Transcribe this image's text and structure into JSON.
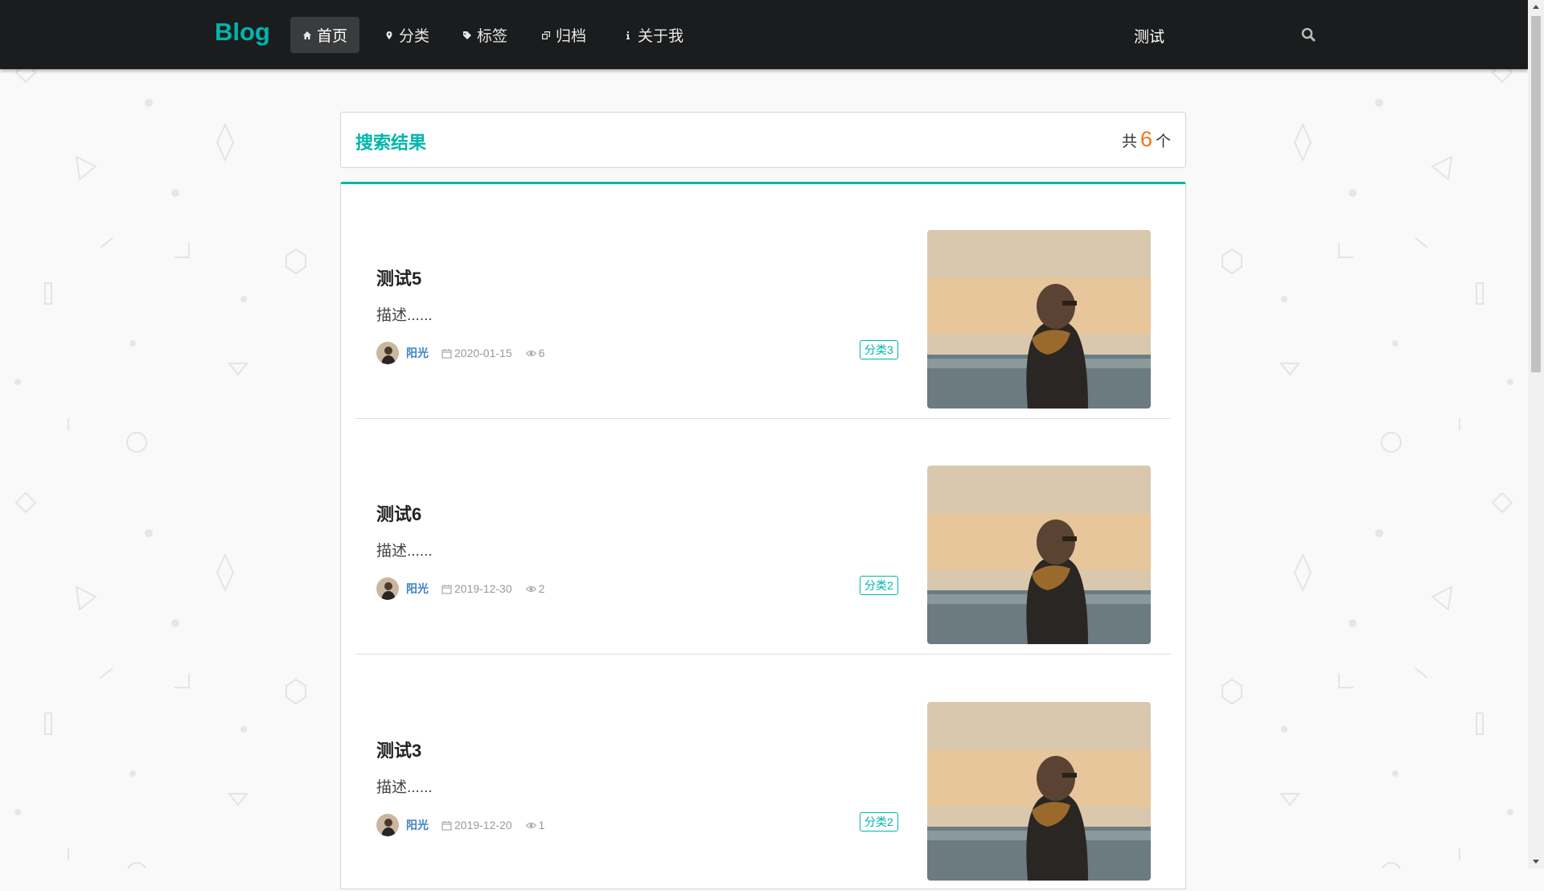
{
  "brand": "Blog",
  "nav": [
    {
      "label": "首页",
      "icon": "home-icon",
      "active": true
    },
    {
      "label": "分类",
      "icon": "map-marker-icon",
      "active": false
    },
    {
      "label": "标签",
      "icon": "tag-icon",
      "active": false
    },
    {
      "label": "归档",
      "icon": "clone-icon",
      "active": false
    },
    {
      "label": "关于我",
      "icon": "info-icon",
      "active": false
    }
  ],
  "user_label": "测试",
  "search_icon": "search-icon",
  "results": {
    "title": "搜索结果",
    "count_prefix": "共",
    "count": "6",
    "count_suffix": "个"
  },
  "posts": [
    {
      "title": "测试5",
      "desc": "描述......",
      "author": "阳光",
      "date": "2020-01-15",
      "views": "6",
      "category": "分类3"
    },
    {
      "title": "测试6",
      "desc": "描述......",
      "author": "阳光",
      "date": "2019-12-30",
      "views": "2",
      "category": "分类2"
    },
    {
      "title": "测试3",
      "desc": "描述......",
      "author": "阳光",
      "date": "2019-12-20",
      "views": "1",
      "category": "分类2"
    }
  ],
  "colors": {
    "accent": "#00b5ad",
    "navbar_bg": "#1b1c1d",
    "count_highlight": "#f2711c",
    "author_link": "#4183c4"
  }
}
